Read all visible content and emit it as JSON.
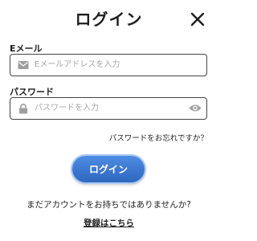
{
  "header": {
    "title": "ログイン",
    "close_icon": "close-icon"
  },
  "email": {
    "label": "Eメール",
    "value": "",
    "placeholder": "Eメールアドレスを入力",
    "icon": "mail-icon"
  },
  "password": {
    "label": "パスワード",
    "value": "",
    "placeholder": "パスワードを入力",
    "icon": "lock-icon",
    "toggle_icon": "eye-icon"
  },
  "forgot_password": "パスワードをお忘れですか？",
  "login_button": "ログイン",
  "signup": {
    "prompt": "まだアカウントをお持ちではありませんか?",
    "link": "登録はこちら"
  },
  "colors": {
    "accent": "#3c77cf",
    "text": "#1e1e1e",
    "border": "#444444",
    "placeholder": "#a5a5a5",
    "icon": "#9e9e9e"
  }
}
